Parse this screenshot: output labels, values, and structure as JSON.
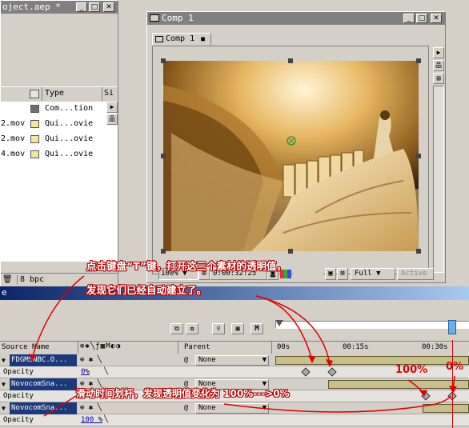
{
  "project_window": {
    "title": "oject.aep *",
    "column_type": "Type",
    "column_size_partial": "Si",
    "rows": [
      {
        "name": "",
        "type": "Com...tion",
        "swatch": "#707070"
      },
      {
        "name": "2.mov",
        "type": "Qui...ovie",
        "swatch": "#f0e8a0"
      },
      {
        "name": "2.mov",
        "type": "Qui...ovie",
        "swatch": "#f0e8a0"
      },
      {
        "name": "4.mov",
        "type": "Qui...ovie",
        "swatch": "#f0e8a0"
      }
    ],
    "bpc_label": "8 bpc"
  },
  "comp_window": {
    "title": "Comp 1",
    "tab_label": "Comp 1",
    "zoom": "100%",
    "timecode": "0:00:32:25",
    "resolution": "Full",
    "view": "Active"
  },
  "timeline": {
    "title_partial": "e",
    "col_source_name": "Source Name",
    "col_parent": "Parent",
    "ruler_labels": [
      "00s",
      "00:15s",
      "00:30s"
    ],
    "layers": [
      {
        "name": "FDGMSNBC.O...",
        "parent": "None",
        "opacity_label": "Opacity",
        "opacity_value": "0",
        "opacity_unit": "%"
      },
      {
        "name": "NovocomSna...",
        "parent": "None",
        "opacity_label": "Opacity",
        "opacity_value": "",
        "opacity_unit": ""
      },
      {
        "name": "NovocomSna...",
        "parent": "None",
        "opacity_label": "Opacity",
        "opacity_value": "100",
        "opacity_unit": "%"
      }
    ]
  },
  "annotations": {
    "line1": "点击键盘“T”键，打开这三个素材的透明值，",
    "line2": "发现它们已经自动建立了。",
    "line3": "滑动时间划杆，发现透明值变化为 100%--->0%",
    "pct_100": "100%",
    "pct_0": "0%"
  }
}
